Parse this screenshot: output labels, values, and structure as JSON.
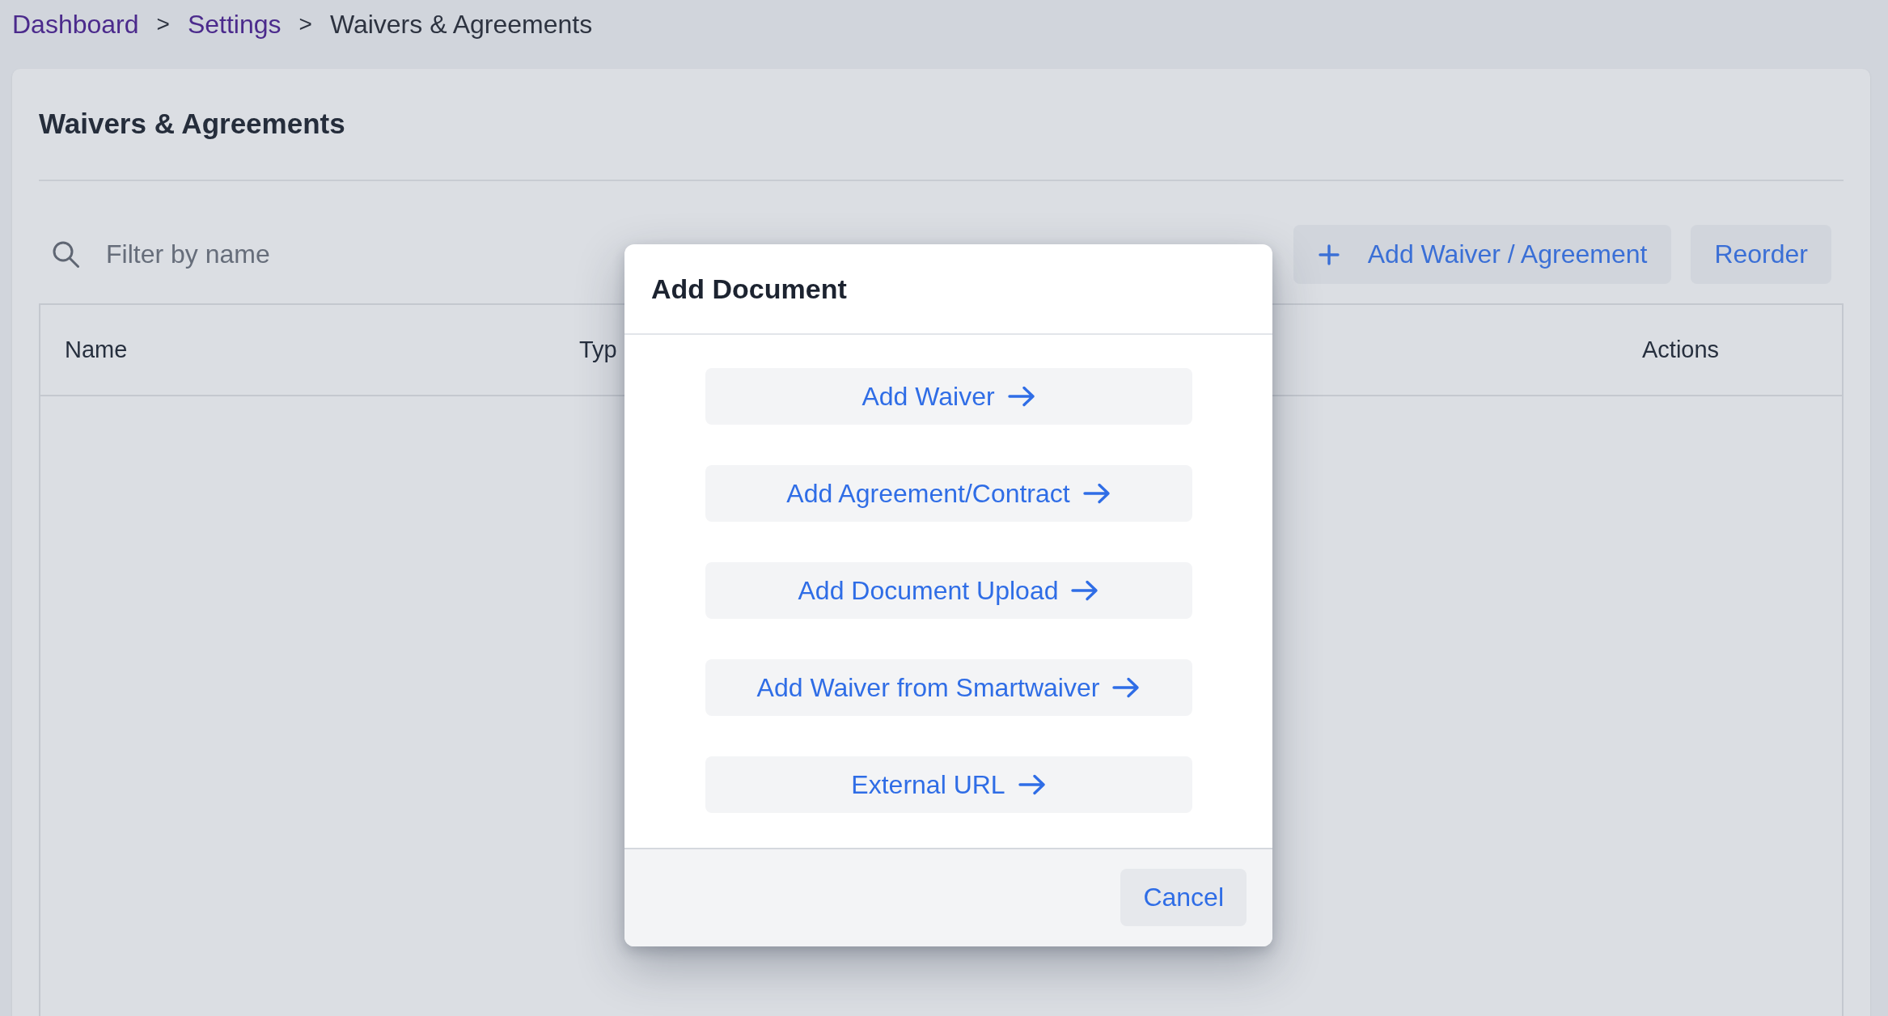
{
  "breadcrumb": [
    {
      "kind": "link",
      "label": "Dashboard"
    },
    {
      "kind": "separator",
      "label": ">"
    },
    {
      "kind": "link",
      "label": "Settings"
    },
    {
      "kind": "separator",
      "label": ">"
    },
    {
      "kind": "current",
      "label": "Waivers & Agreements"
    }
  ],
  "page": {
    "title": "Waivers & Agreements"
  },
  "toolbar": {
    "search": {
      "placeholder": "Filter by name"
    },
    "buttons": [
      {
        "kind": "add",
        "label": "Add Waiver / Agreement"
      },
      {
        "kind": "plain",
        "label": "Reorder"
      }
    ]
  },
  "table": {
    "columns": [
      "Name",
      "Typ",
      "Actions"
    ]
  },
  "dialog": {
    "title": "Add Document",
    "options": [
      "Add Waiver",
      "Add Agreement/Contract",
      "Add Document Upload",
      "Add Waiver from Smartwaiver",
      "External URL"
    ],
    "buttons": [
      "Cancel"
    ]
  }
}
